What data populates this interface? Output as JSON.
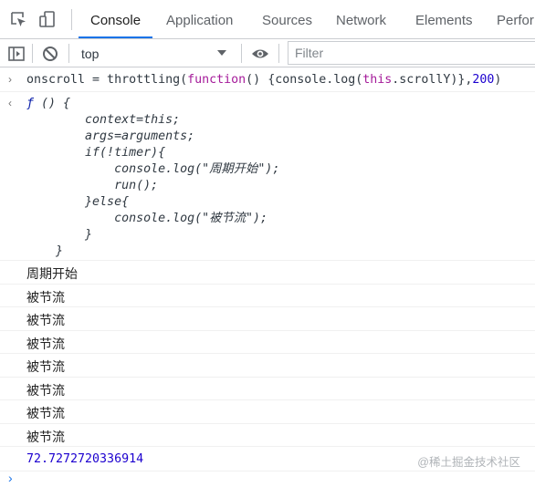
{
  "tabs": {
    "console": "Console",
    "application": "Application",
    "sources": "Sources",
    "network": "Network",
    "elements": "Elements",
    "performance": "Perfor"
  },
  "toolbar": {
    "context": "top",
    "filter_placeholder": "Filter"
  },
  "console": {
    "command": {
      "t1": "onscroll = throttling(",
      "t2": "function",
      "t3": "() {console.log(",
      "t4": "this",
      "t5": ".scrollY)},",
      "t6": "200",
      "t7": ")"
    },
    "fn": {
      "symbol": "ƒ",
      "l1": " () {",
      "l2": "        context=this;",
      "l3": "        args=arguments;",
      "l4": "        if(!timer){",
      "l5": "            console.log(\"周期开始\");",
      "l6": "            run();",
      "l7": "        }else{",
      "l8": "            console.log(\"被节流\");",
      "l9": "        }",
      "l10": "    }"
    },
    "logs": [
      "周期开始",
      "被节流",
      "被节流",
      "被节流",
      "被节流",
      "被节流",
      "被节流",
      "被节流"
    ],
    "number_output": "72.7272720336914",
    "watermark": "@稀土掘金技术社区"
  },
  "colors": {
    "accent": "#1a73e8",
    "keyword": "#a51b9a",
    "number": "#1c00cf"
  }
}
